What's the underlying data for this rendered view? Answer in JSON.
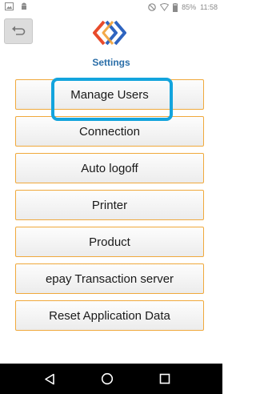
{
  "status_bar": {
    "battery_percent": "85%",
    "time": "11:58",
    "icons": [
      "image-icon",
      "android-icon",
      "dnd-icon",
      "wifi-icon",
      "battery-icon"
    ]
  },
  "header": {
    "back_icon": "back-arrow-icon",
    "logo": "app-logo",
    "title": "Settings",
    "title_color": "#2a6ea8"
  },
  "menu": {
    "items": [
      {
        "label": "Manage Users"
      },
      {
        "label": "Connection"
      },
      {
        "label": "Auto logoff"
      },
      {
        "label": "Printer"
      },
      {
        "label": "Product"
      },
      {
        "label": "epay Transaction server"
      },
      {
        "label": "Reset Application Data"
      }
    ],
    "border_color": "#f0a93c",
    "highlight_color": "#13a4dd"
  },
  "nav_bar": {
    "items": [
      "nav-back-icon",
      "nav-home-icon",
      "nav-recents-icon"
    ]
  }
}
